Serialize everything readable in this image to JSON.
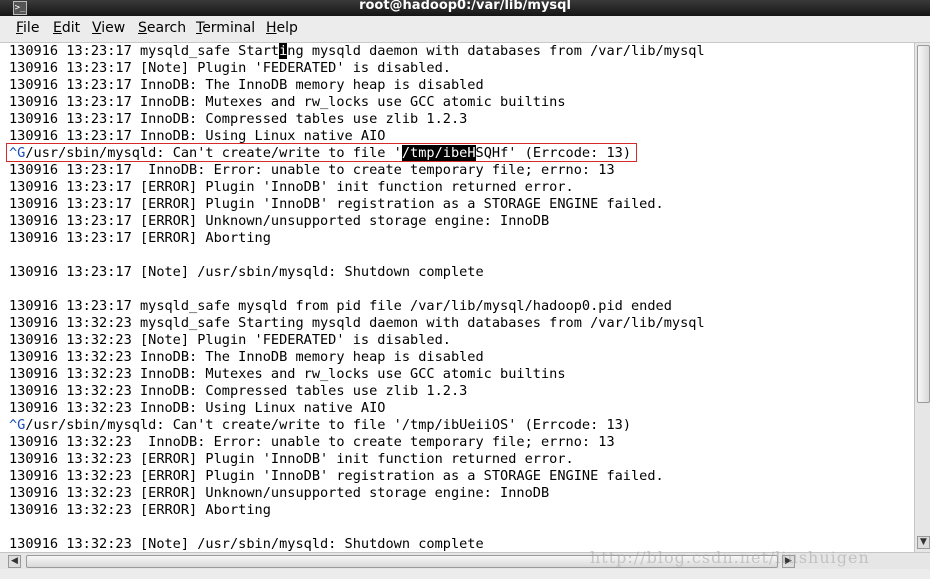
{
  "window": {
    "title": "root@hadoop0:/var/lib/mysql",
    "icon": "terminal-icon"
  },
  "menu": [
    {
      "label": "File",
      "mnemonic": "F",
      "rest": "ile"
    },
    {
      "label": "Edit",
      "mnemonic": "E",
      "rest": "dit"
    },
    {
      "label": "View",
      "mnemonic": "V",
      "rest": "iew"
    },
    {
      "label": "Search",
      "mnemonic": "S",
      "rest": "earch"
    },
    {
      "label": "Terminal",
      "mnemonic": "T",
      "rest": "erminal"
    },
    {
      "label": "Help",
      "mnemonic": "H",
      "rest": "elp"
    }
  ],
  "terminal": {
    "line0": {
      "pre": "130916 13:23:17 mysqld_safe Start",
      "cursor": "i",
      "post": "ng mysqld daemon with databases from /var/lib/mysql"
    },
    "lines_a": [
      "130916 13:23:17 [Note] Plugin 'FEDERATED' is disabled.",
      "130916 13:23:17 InnoDB: The InnoDB memory heap is disabled",
      "130916 13:23:17 InnoDB: Mutexes and rw_locks use GCC atomic builtins",
      "130916 13:23:17 InnoDB: Compressed tables use zlib 1.2.3",
      "130916 13:23:17 InnoDB: Using Linux native AIO"
    ],
    "highlight_line": {
      "caret": "^G",
      "pre": "/usr/sbin/mysqld: Can't create/write to file '",
      "selected": "/tmp/ibeH",
      "post": "SQHf' (Errcode: 13)"
    },
    "lines_b": [
      "130916 13:23:17  InnoDB: Error: unable to create temporary file; errno: 13",
      "130916 13:23:17 [ERROR] Plugin 'InnoDB' init function returned error.",
      "130916 13:23:17 [ERROR] Plugin 'InnoDB' registration as a STORAGE ENGINE failed.",
      "130916 13:23:17 [ERROR] Unknown/unsupported storage engine: InnoDB",
      "130916 13:23:17 [ERROR] Aborting",
      "",
      "130916 13:23:17 [Note] /usr/sbin/mysqld: Shutdown complete",
      "",
      "130916 13:23:17 mysqld_safe mysqld from pid file /var/lib/mysql/hadoop0.pid ended",
      "130916 13:32:23 mysqld_safe Starting mysqld daemon with databases from /var/lib/mysql",
      "130916 13:32:23 [Note] Plugin 'FEDERATED' is disabled.",
      "130916 13:32:23 InnoDB: The InnoDB memory heap is disabled",
      "130916 13:32:23 InnoDB: Mutexes and rw_locks use GCC atomic builtins",
      "130916 13:32:23 InnoDB: Compressed tables use zlib 1.2.3",
      "130916 13:32:23 InnoDB: Using Linux native AIO"
    ],
    "line_caret2": {
      "caret": "^G",
      "text": "/usr/sbin/mysqld: Can't create/write to file '/tmp/ibUeiiOS' (Errcode: 13)"
    },
    "lines_c": [
      "130916 13:32:23  InnoDB: Error: unable to create temporary file; errno: 13",
      "130916 13:32:23 [ERROR] Plugin 'InnoDB' init function returned error.",
      "130916 13:32:23 [ERROR] Plugin 'InnoDB' registration as a STORAGE ENGINE failed.",
      "130916 13:32:23 [ERROR] Unknown/unsupported storage engine: InnoDB",
      "130916 13:32:23 [ERROR] Aborting",
      "",
      "130916 13:32:23 [Note] /usr/sbin/mysqld: Shutdown complete"
    ]
  },
  "watermark": "http://blog.csdn.net/liushuigen",
  "colors": {
    "highlight_box": "#d42a2a",
    "caret": "#1a4fb5",
    "selection_bg": "#000000"
  }
}
